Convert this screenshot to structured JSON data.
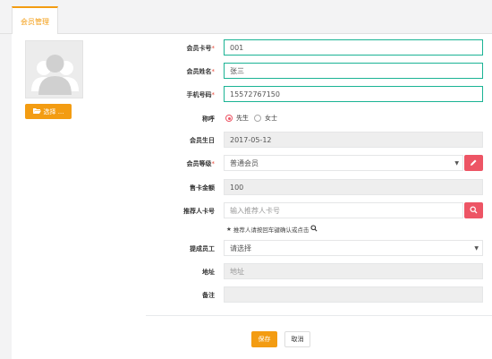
{
  "tab": {
    "label": "会员管理"
  },
  "avatar": {
    "choose_label": "选择 ..."
  },
  "form": {
    "card_no": {
      "label": "会员卡号",
      "value": "001"
    },
    "name": {
      "label": "会员姓名",
      "value": "张三"
    },
    "phone": {
      "label": "手机号码",
      "value": "15572767150"
    },
    "title": {
      "label": "称呼",
      "options": [
        "先生",
        "女士"
      ],
      "selected": "先生"
    },
    "birthday": {
      "label": "会员生日",
      "value": "2017-05-12"
    },
    "level": {
      "label": "会员等级",
      "value": "普通会员"
    },
    "price": {
      "label": "售卡金额",
      "value": "100"
    },
    "referrer": {
      "label": "推荐人卡号",
      "placeholder": "输入推荐人卡号"
    },
    "referrer_hint": "推荐人请按回车键确认或点击",
    "staff": {
      "label": "提成员工",
      "value": "请选择"
    },
    "address": {
      "label": "地址",
      "placeholder": "地址"
    },
    "remark": {
      "label": "备注",
      "placeholder": ""
    }
  },
  "required_mark": "*",
  "buttons": {
    "save": "保存",
    "cancel": "取消"
  },
  "colors": {
    "accent": "#f39c12",
    "danger": "#ed5565",
    "focus_border": "#1ab394"
  }
}
